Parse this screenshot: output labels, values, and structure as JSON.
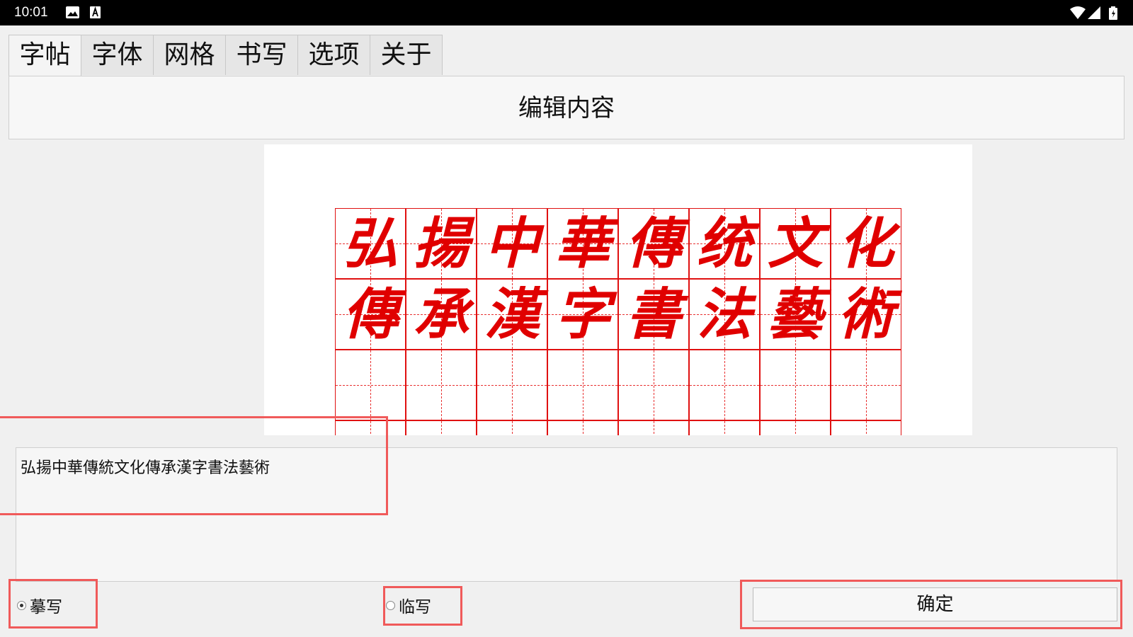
{
  "status_bar": {
    "time": "10:01"
  },
  "tabs": [
    "字帖",
    "字体",
    "网格",
    "书写",
    "选项",
    "关于"
  ],
  "edit_button_label": "编辑内容",
  "preview": {
    "characters": [
      "弘",
      "揚",
      "中",
      "華",
      "傳",
      "统",
      "文",
      "化",
      "傳",
      "承",
      "漢",
      "字",
      "書",
      "法",
      "藝",
      "術"
    ],
    "columns": 8,
    "rows": 4,
    "color": "#e00000"
  },
  "content_text": "弘揚中華傳統文化傳承漢字書法藝術",
  "radio_options": [
    {
      "label": "摹写",
      "selected": true
    },
    {
      "label": "临写",
      "selected": false
    }
  ],
  "ok_button_label": "确定"
}
